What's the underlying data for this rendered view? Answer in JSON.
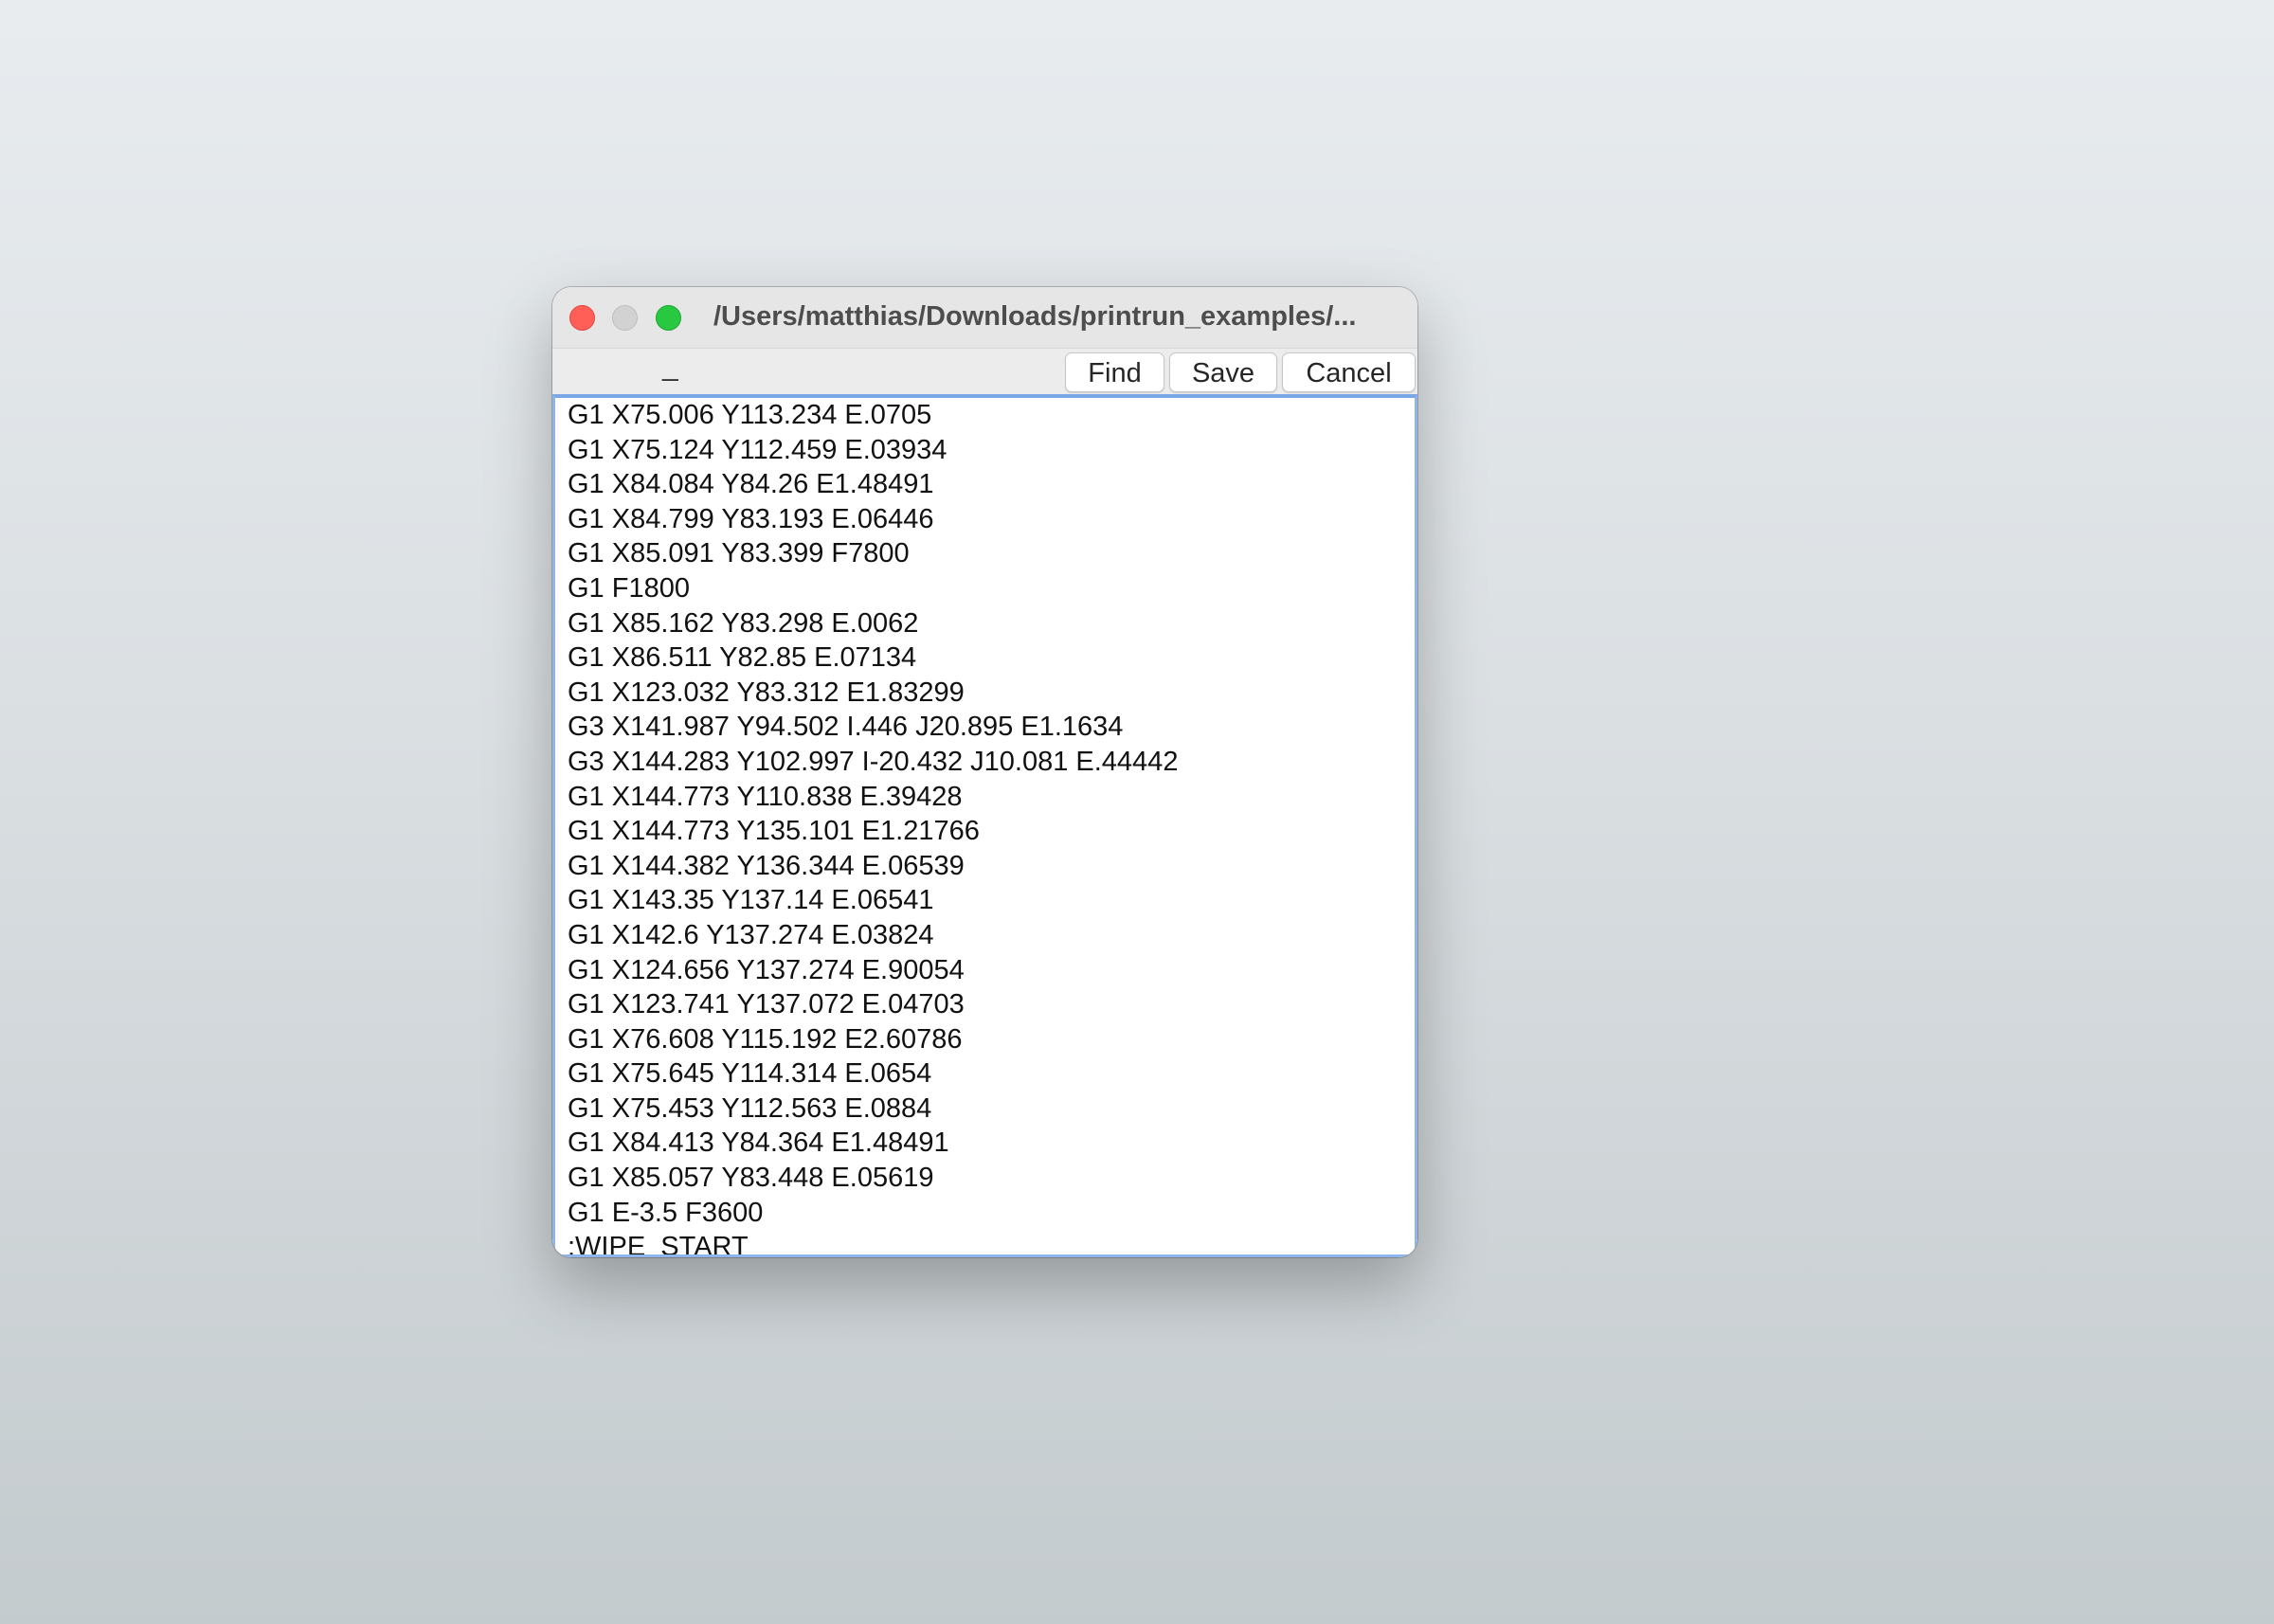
{
  "window": {
    "title": "/Users/matthias/Downloads/printrun_examples/..."
  },
  "toolbar": {
    "cursor_text": "_",
    "find_label": "Find",
    "save_label": "Save",
    "cancel_label": "Cancel"
  },
  "editor": {
    "lines": [
      "G1 X75.006 Y113.234 E.0705",
      "G1 X75.124 Y112.459 E.03934",
      "G1 X84.084 Y84.26 E1.48491",
      "G1 X84.799 Y83.193 E.06446",
      "G1 X85.091 Y83.399 F7800",
      "G1 F1800",
      "G1 X85.162 Y83.298 E.0062",
      "G1 X86.511 Y82.85 E.07134",
      "G1 X123.032 Y83.312 E1.83299",
      "G3 X141.987 Y94.502 I.446 J20.895 E1.1634",
      "G3 X144.283 Y102.997 I-20.432 J10.081 E.44442",
      "G1 X144.773 Y110.838 E.39428",
      "G1 X144.773 Y135.101 E1.21766",
      "G1 X144.382 Y136.344 E.06539",
      "G1 X143.35 Y137.14 E.06541",
      "G1 X142.6 Y137.274 E.03824",
      "G1 X124.656 Y137.274 E.90054",
      "G1 X123.741 Y137.072 E.04703",
      "G1 X76.608 Y115.192 E2.60786",
      "G1 X75.645 Y114.314 E.0654",
      "G1 X75.453 Y112.563 E.0884",
      "G1 X84.413 Y84.364 E1.48491",
      "G1 X85.057 Y83.448 E.05619",
      "G1 E-3.5 F3600",
      ";WIPE_START"
    ]
  },
  "colors": {
    "close": "#ff5f57",
    "minimize": "#d2d2d2",
    "zoom": "#28c840",
    "focus_ring": "#7aa7e6"
  }
}
